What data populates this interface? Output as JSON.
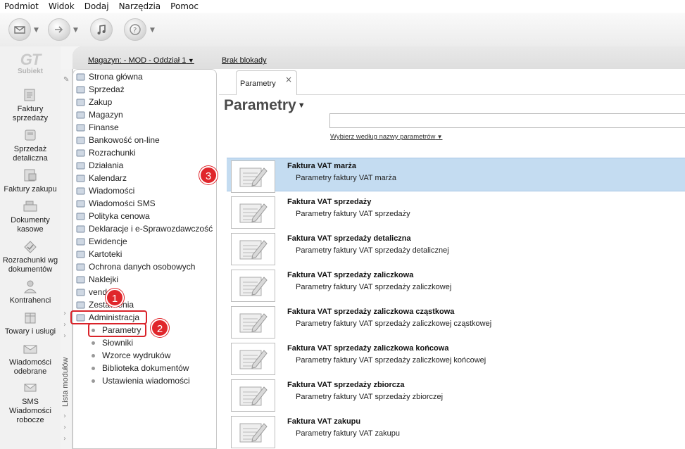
{
  "menu": [
    "Podmiot",
    "Widok",
    "Dodaj",
    "Narzędzia",
    "Pomoc"
  ],
  "toolbar": {
    "buttons": [
      "envelope-arrow-icon",
      "forward-arrow-icon",
      "music-note-icon",
      "help-icon"
    ]
  },
  "logo": {
    "mark": "GT",
    "text": "Subiekt"
  },
  "leftnav": [
    {
      "label": "Faktury sprzedaży",
      "icon": "invoice-icon"
    },
    {
      "label": "Sprzedaż detaliczna",
      "icon": "receipt-icon"
    },
    {
      "label": "Faktury zakupu",
      "icon": "purchase-invoice-icon"
    },
    {
      "label": "Dokumenty kasowe",
      "icon": "cash-register-icon"
    },
    {
      "label": "Rozrachunki wg dokumentów",
      "icon": "settlement-icon"
    },
    {
      "label": "Kontrahenci",
      "icon": "contractor-icon"
    },
    {
      "label": "Towary i usługi",
      "icon": "goods-icon"
    },
    {
      "label": "Wiadomości odebrane",
      "icon": "mail-received-icon"
    },
    {
      "label": "SMS Wiadomości robocze",
      "icon": "sms-draft-icon"
    }
  ],
  "topbar": {
    "warehouse": "Magazyn: - MOD - Oddział 1",
    "blocks": "Brak blokady"
  },
  "module_list_label": "Lista modułów",
  "tree": [
    {
      "label": "Strona główna",
      "icon": "home-icon"
    },
    {
      "label": "Sprzedaż",
      "icon": "sales-icon"
    },
    {
      "label": "Zakup",
      "icon": "purchase-icon"
    },
    {
      "label": "Magazyn",
      "icon": "warehouse-icon"
    },
    {
      "label": "Finanse",
      "icon": "finance-icon"
    },
    {
      "label": "Bankowość on-line",
      "icon": "bank-icon"
    },
    {
      "label": "Rozrachunki",
      "icon": "settlements-icon"
    },
    {
      "label": "Działania",
      "icon": "actions-icon"
    },
    {
      "label": "Kalendarz",
      "icon": "calendar-icon"
    },
    {
      "label": "Wiadomości",
      "icon": "messages-icon"
    },
    {
      "label": "Wiadomości SMS",
      "icon": "sms-icon"
    },
    {
      "label": "Polityka cenowa",
      "icon": "price-tag-icon"
    },
    {
      "label": "Deklaracje i e-Sprawozdawczość",
      "icon": "declaration-icon"
    },
    {
      "label": "Ewidencje",
      "icon": "records-icon"
    },
    {
      "label": "Kartoteki",
      "icon": "files-icon"
    },
    {
      "label": "Ochrona danych osobowych",
      "icon": "shield-icon"
    },
    {
      "label": "Naklejki",
      "icon": "label-icon"
    },
    {
      "label": "vendero",
      "icon": "vendero-icon"
    },
    {
      "label": "Zestawienia",
      "icon": "report-icon"
    },
    {
      "label": "Administracja",
      "icon": "admin-icon"
    }
  ],
  "tree_sub": [
    "Parametry",
    "Słowniki",
    "Wzorce wydruków",
    "Biblioteka dokumentów",
    "Ustawienia wiadomości"
  ],
  "tab": {
    "label": "Parametry",
    "close": "×"
  },
  "content": {
    "title": "Parametry",
    "search_placeholder": "",
    "filter_label": "Wybierz według nazwy parametrów"
  },
  "rows": [
    {
      "title": "Faktura VAT marża",
      "desc": "Parametry faktury VAT marża",
      "selected": true
    },
    {
      "title": "Faktura VAT sprzedaży",
      "desc": "Parametry faktury VAT sprzedaży",
      "selected": false
    },
    {
      "title": "Faktura VAT sprzedaży detaliczna",
      "desc": "Parametry faktury VAT sprzedaży detalicznej",
      "selected": false
    },
    {
      "title": "Faktura VAT sprzedaży zaliczkowa",
      "desc": "Parametry faktury VAT sprzedaży zaliczkowej",
      "selected": false
    },
    {
      "title": "Faktura VAT sprzedaży zaliczkowa cząstkowa",
      "desc": "Parametry faktury VAT sprzedaży zaliczkowej cząstkowej",
      "selected": false
    },
    {
      "title": "Faktura VAT sprzedaży zaliczkowa końcowa",
      "desc": "Parametry faktury VAT sprzedaży zaliczkowej końcowej",
      "selected": false
    },
    {
      "title": "Faktura VAT sprzedaży zbiorcza",
      "desc": "Parametry faktury VAT sprzedaży zbiorczej",
      "selected": false
    },
    {
      "title": "Faktura VAT zakupu",
      "desc": "Parametry faktury VAT zakupu",
      "selected": false
    }
  ],
  "callouts": [
    "1",
    "2",
    "3"
  ],
  "colors": {
    "highlight": "#d9232a",
    "selection": "#c4dcf1"
  }
}
